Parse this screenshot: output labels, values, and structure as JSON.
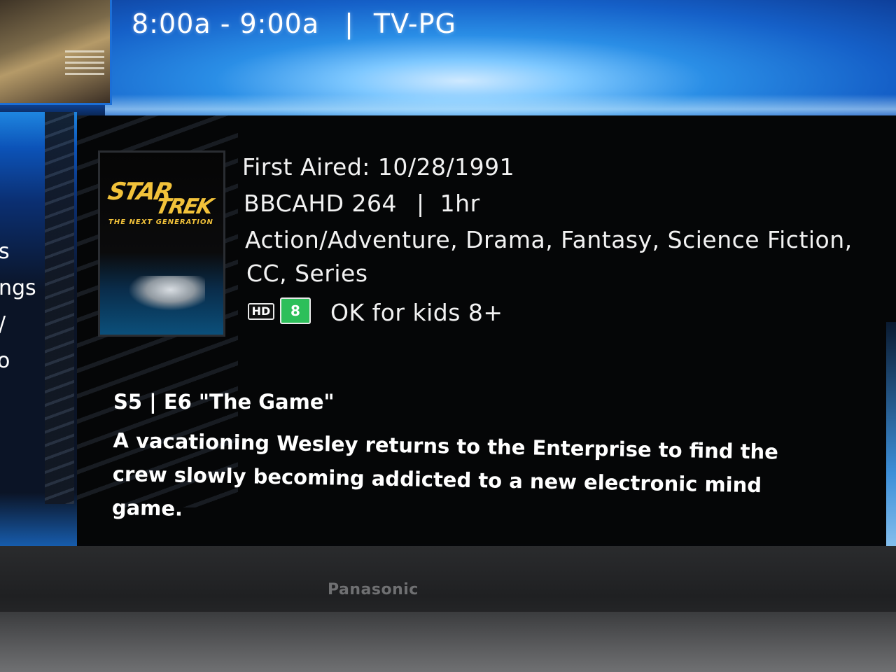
{
  "header": {
    "time_range": "8:00a - 9:00a",
    "separator": "|",
    "rating": "TV-PG"
  },
  "side_menu": {
    "items": [
      "s",
      "ngs",
      "/",
      "o"
    ]
  },
  "program": {
    "poster": {
      "logo_line1": "STAR",
      "logo_line2": "TREK",
      "logo_line3": "THE NEXT GENERATION"
    },
    "first_aired": "First Aired: 10/28/1991",
    "channel": "BBCAHD 264",
    "separator": "|",
    "duration": "1hr",
    "genres_line1": "Action/Adventure, Drama, Fantasy, Science Fiction,",
    "genres_line2": "CC, Series",
    "hd_badge": "HD",
    "age_badge": "8",
    "kids_rating": "OK for kids 8+",
    "episode_title": "S5 | E6 \"The Game\"",
    "description": "A vacationing Wesley returns to the Enterprise to find the crew slowly becoming addicted to a new electronic mind game."
  },
  "tv": {
    "brand": "Panasonic"
  },
  "colors": {
    "age_badge_bg": "#2dbf5a",
    "poster_logo": "#f2c23a",
    "accent_blue": "#1d6fd6"
  }
}
